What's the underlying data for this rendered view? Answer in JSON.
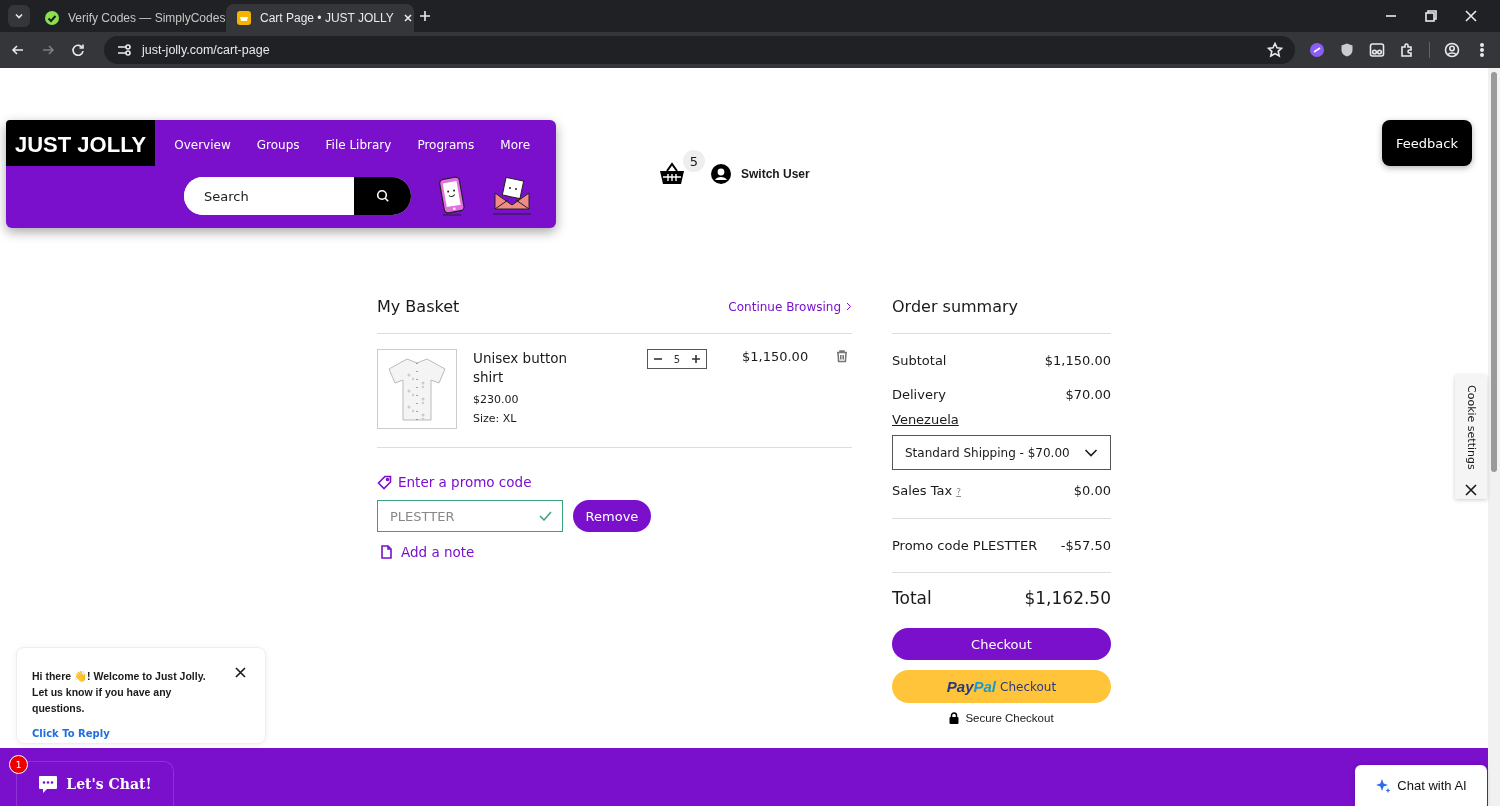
{
  "browser": {
    "tabs": [
      {
        "title": "Verify Codes — SimplyCodes",
        "selected": false
      },
      {
        "title": "Cart Page • JUST JOLLY",
        "selected": true
      }
    ],
    "url": "just-jolly.com/cart-page"
  },
  "header": {
    "logo": "JUST JOLLY",
    "nav": [
      "Overview",
      "Groups",
      "File Library",
      "Programs",
      "More"
    ],
    "search": {
      "placeholder": "Search"
    },
    "cart_count": "5",
    "user": "Switch User"
  },
  "feedback": "Feedback",
  "basket": {
    "title": "My Basket",
    "continue": "Continue Browsing",
    "items": [
      {
        "name": "Unisex button shirt",
        "price": "$230.00",
        "size": "Size: XL",
        "quantity": "5",
        "total": "$1,150.00"
      }
    ],
    "promo_link": "Enter a promo code",
    "promo": {
      "value": "PLESTTER",
      "valid": true
    },
    "remove": "Remove",
    "note": "Add a note"
  },
  "summary": {
    "title": "Order summary",
    "rows": [
      {
        "label": "Subtotal",
        "value": "$1,150.00"
      },
      {
        "label": "Delivery",
        "value": "$70.00"
      }
    ],
    "country": "Venezuela",
    "shipping": "Standard Shipping - $70.00",
    "tax": {
      "label": "Sales Tax",
      "hint": "?",
      "value": "$0.00"
    },
    "promo": {
      "label": "Promo code PLESTTER",
      "value": "-$57.50"
    },
    "total": {
      "label": "Total",
      "value": "$1,162.50"
    },
    "checkout": "Checkout",
    "paypal": {
      "logo": [
        "Pay",
        "Pal"
      ],
      "label": "Checkout"
    },
    "secure": "Secure Checkout"
  },
  "cookie": "Cookie settings",
  "chat": {
    "message": "Hi there 👋! Welcome to Just Jolly. Let us know if you have any questions.",
    "reply": "Click To Reply",
    "badge": "1",
    "button": "Let's Chat!",
    "ai": "Chat with AI"
  }
}
